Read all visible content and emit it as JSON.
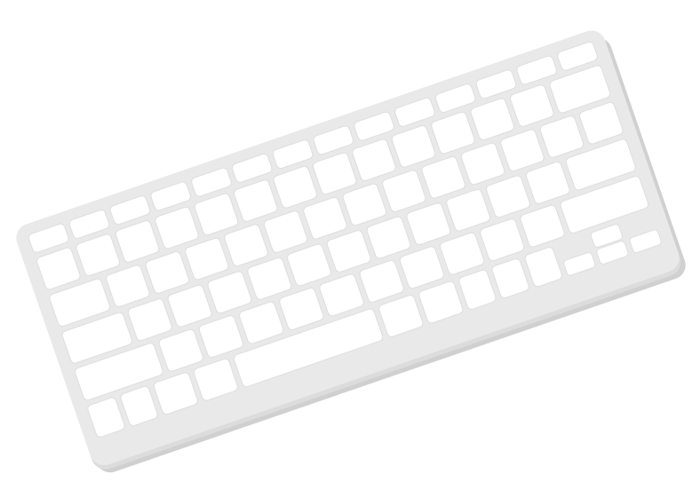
{
  "colors": {
    "background": "#ffffff",
    "case_top": "#e9e9e9",
    "case_edge": "#dcdcdc",
    "case_shadow": "#d0d0d0",
    "key_fill": "#ffffff",
    "key_stroke": "#dedede"
  },
  "keyboard": {
    "icon": "keyboard-icon",
    "layout": "compact-wireless",
    "rows": [
      {
        "name": "function-row",
        "keys": [
          1,
          1,
          1,
          1,
          1,
          1,
          1,
          1,
          1,
          1,
          1,
          1,
          1,
          1
        ],
        "short": true
      },
      {
        "name": "number-row",
        "keys": [
          1,
          1,
          1,
          1,
          1,
          1,
          1,
          1,
          1,
          1,
          1,
          1,
          1,
          1.5
        ]
      },
      {
        "name": "top-letter-row",
        "keys": [
          1.5,
          1,
          1,
          1,
          1,
          1,
          1,
          1,
          1,
          1,
          1,
          1,
          1,
          1
        ]
      },
      {
        "name": "home-row",
        "keys": [
          1.75,
          1,
          1,
          1,
          1,
          1,
          1,
          1,
          1,
          1,
          1,
          1,
          1.75
        ]
      },
      {
        "name": "bottom-letter-row",
        "keys": [
          2.25,
          1,
          1,
          1,
          1,
          1,
          1,
          1,
          1,
          1,
          1,
          2.25
        ]
      },
      {
        "name": "modifier-row",
        "keys": [
          1,
          1,
          1.25,
          1.25,
          5,
          1.25,
          1.25,
          1,
          1,
          1
        ],
        "arrows": true
      }
    ]
  }
}
